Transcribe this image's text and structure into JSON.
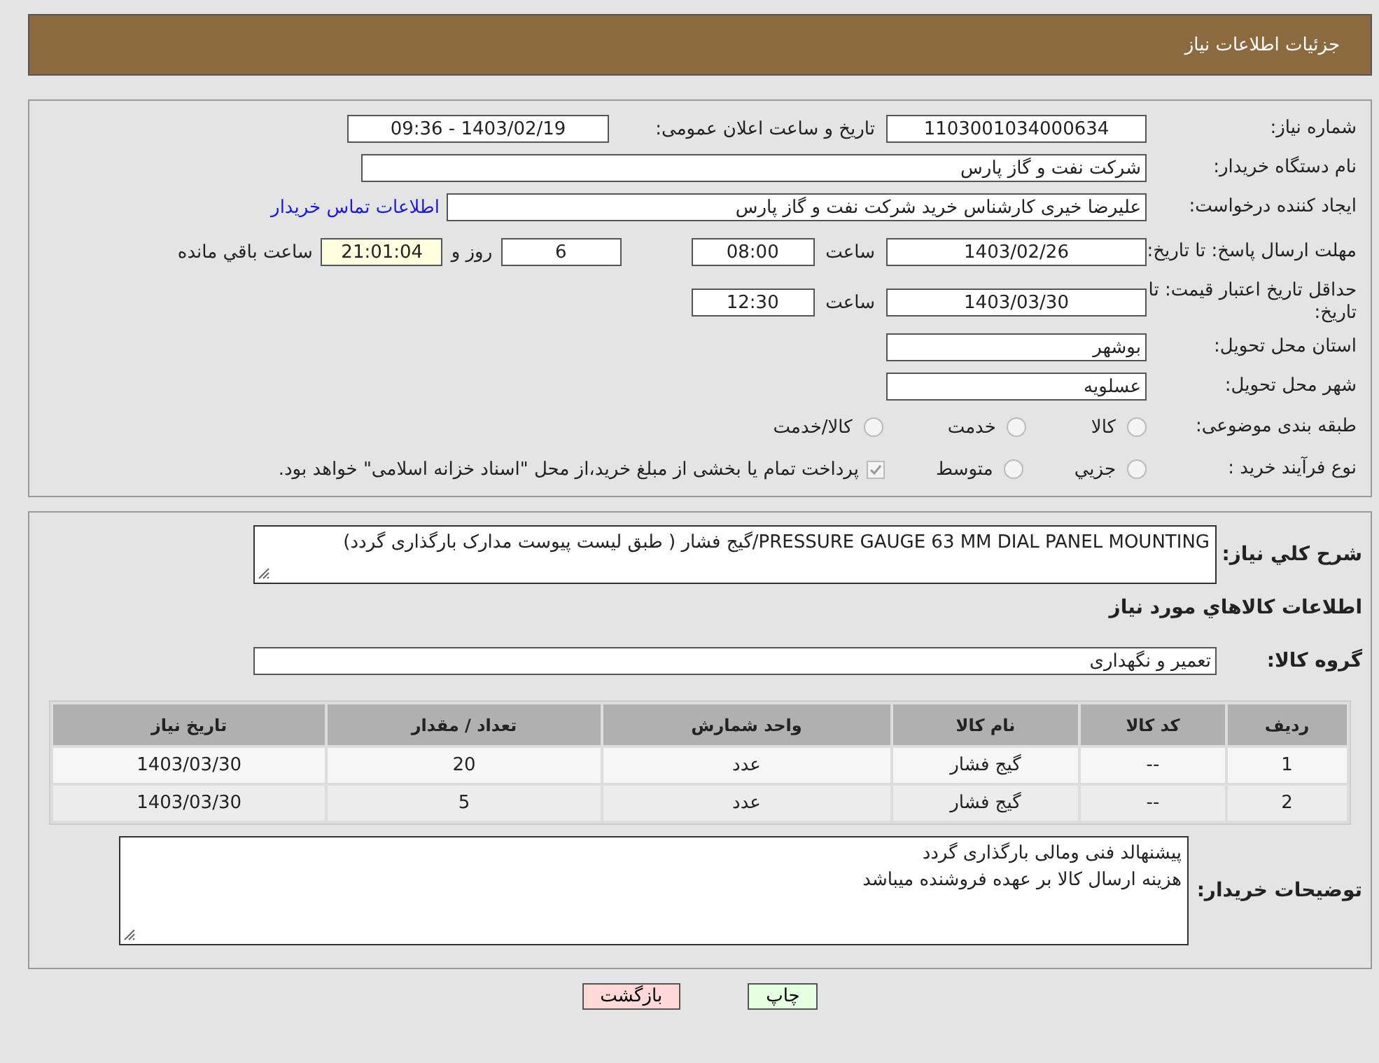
{
  "header": {
    "title": "جزئیات اطلاعات نیاز"
  },
  "need_number": {
    "label": "شماره نیاز:",
    "value": "1103001034000634"
  },
  "announce": {
    "label": "تاریخ و ساعت اعلان عمومی:",
    "value": "1403/02/19 - 09:36"
  },
  "buyer_org": {
    "label": "نام دستگاه خریدار:",
    "value": "شرکت نفت و گاز پارس"
  },
  "creator": {
    "label": "ایجاد کننده درخواست:",
    "value": "علیرضا  خیری کارشناس خرید  شرکت نفت و گاز پارس",
    "link": "اطلاعات تماس خریدار"
  },
  "reply_deadline": {
    "label": "مهلت ارسال پاسخ: تا تاریخ:",
    "date": "1403/02/26",
    "time_label": "ساعت",
    "time": "08:00",
    "days": "6",
    "days_label": "روز و",
    "remaining": "21:01:04",
    "remaining_label": "ساعت باقي مانده"
  },
  "price_validity": {
    "label": "حداقل تاریخ اعتبار قیمت: تا تاریخ:",
    "date": "1403/03/30",
    "time_label": "ساعت",
    "time": "12:30"
  },
  "province": {
    "label": "استان محل تحویل:",
    "value": "بوشهر"
  },
  "city": {
    "label": "شهر محل تحویل:",
    "value": "عسلویه"
  },
  "category": {
    "label": "طبقه بندی موضوعی:",
    "options": [
      {
        "label": "کالا",
        "selected": false
      },
      {
        "label": "خدمت",
        "selected": false
      },
      {
        "label": "کالا/خدمت",
        "selected": false
      }
    ]
  },
  "purchase_type": {
    "label": "نوع فرآیند خرید :",
    "options": [
      {
        "label": "جزيي",
        "selected": false
      },
      {
        "label": "متوسط",
        "selected": false
      }
    ],
    "treasury": {
      "label": "پرداخت تمام یا بخشی از مبلغ خرید،از محل \"اسناد خزانه اسلامی\" خواهد بود.",
      "checked": true
    }
  },
  "description": {
    "label": "شرح كلي نياز:",
    "value": "PRESSURE GAUGE 63 MM DIAL PANEL MOUNTING/گیج فشار ( طبق لیست پیوست مدارک بارگذاری گردد)"
  },
  "goods_heading": "اطلاعات كالاهاي مورد نياز",
  "goods_group": {
    "label": "گروه کالا:",
    "value": "تعمیر و نگهداری"
  },
  "table": {
    "columns": [
      "رديف",
      "کد کالا",
      "نام کالا",
      "واحد شمارش",
      "تعداد / مقدار",
      "تاریخ نیاز"
    ],
    "rows": [
      [
        "1",
        "--",
        "گیج فشار",
        "عدد",
        "20",
        "1403/03/30"
      ],
      [
        "2",
        "--",
        "گیج فشار",
        "عدد",
        "5",
        "1403/03/30"
      ]
    ]
  },
  "buyer_notes": {
    "label": "توضیحات خریدار:",
    "lines": [
      "پیشنهالد فنی ومالی بارگذاری گردد",
      "هزینه ارسال کالا بر عهده فروشنده میباشد"
    ]
  },
  "buttons": [
    {
      "label": "چاپ",
      "kind": "print"
    },
    {
      "label": "بازگشت",
      "kind": "back"
    }
  ]
}
